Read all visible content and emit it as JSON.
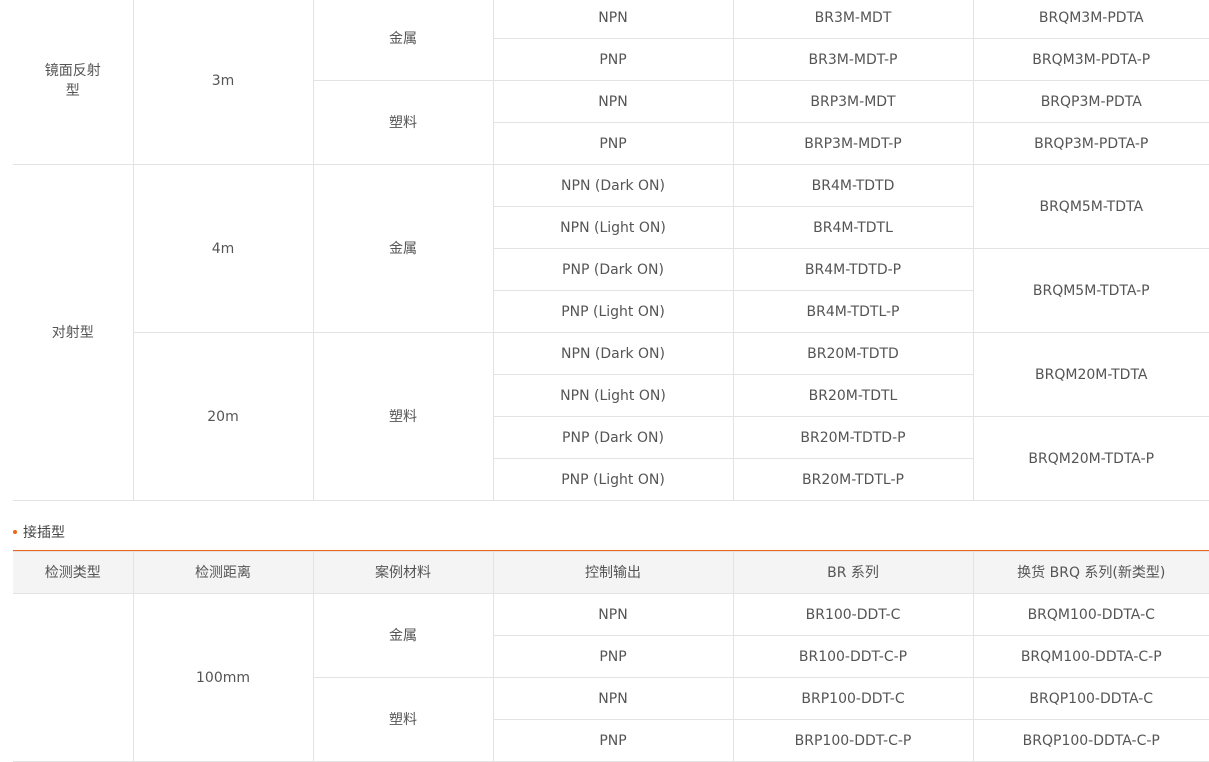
{
  "table1": {
    "r1": {
      "type": "镜面反射型",
      "dist": "3m",
      "mat_metal": "金属",
      "mat_plastic": "塑料",
      "rows": [
        {
          "out": "NPN",
          "br": "BR3M-MDT",
          "brq": "BRQM3M-PDTA"
        },
        {
          "out": "PNP",
          "br": "BR3M-MDT-P",
          "brq": "BRQM3M-PDTA-P"
        },
        {
          "out": "NPN",
          "br": "BRP3M-MDT",
          "brq": "BRQP3M-PDTA"
        },
        {
          "out": "PNP",
          "br": "BRP3M-MDT-P",
          "brq": "BRQP3M-PDTA-P"
        }
      ]
    },
    "r2": {
      "type": "对射型",
      "g1": {
        "dist": "4m",
        "mat": "金属",
        "rows": [
          {
            "out": "NPN (Dark ON)",
            "br": "BR4M-TDTD"
          },
          {
            "out": "NPN (Light ON)",
            "br": "BR4M-TDTL"
          },
          {
            "out": "PNP (Dark ON)",
            "br": "BR4M-TDTD-P"
          },
          {
            "out": "PNP (Light ON)",
            "br": "BR4M-TDTL-P"
          }
        ],
        "brq_a": "BRQM5M-TDTA",
        "brq_b": "BRQM5M-TDTA-P"
      },
      "g2": {
        "dist": "20m",
        "mat": "塑料",
        "rows": [
          {
            "out": "NPN (Dark ON)",
            "br": "BR20M-TDTD"
          },
          {
            "out": "NPN (Light ON)",
            "br": "BR20M-TDTL"
          },
          {
            "out": "PNP (Dark ON)",
            "br": "BR20M-TDTD-P"
          },
          {
            "out": "PNP (Light ON)",
            "br": "BR20M-TDTL-P"
          }
        ],
        "brq_a": "BRQM20M-TDTA",
        "brq_b": "BRQM20M-TDTA-P"
      }
    }
  },
  "section2": {
    "title": "接插型"
  },
  "table2": {
    "headers": [
      "检测类型",
      "检测距离",
      "案例材料",
      "控制输出",
      "BR 系列",
      "换货 BRQ 系列(新类型)"
    ],
    "dist": "100mm",
    "mat_metal": "金属",
    "mat_plastic": "塑料",
    "rows": [
      {
        "out": "NPN",
        "br": "BR100-DDT-C",
        "brq": "BRQM100-DDTA-C"
      },
      {
        "out": "PNP",
        "br": "BR100-DDT-C-P",
        "brq": "BRQM100-DDTA-C-P"
      },
      {
        "out": "NPN",
        "br": "BRP100-DDT-C",
        "brq": "BRQP100-DDTA-C"
      },
      {
        "out": "PNP",
        "br": "BRP100-DDT-C-P",
        "brq": "BRQP100-DDTA-C-P"
      }
    ]
  }
}
